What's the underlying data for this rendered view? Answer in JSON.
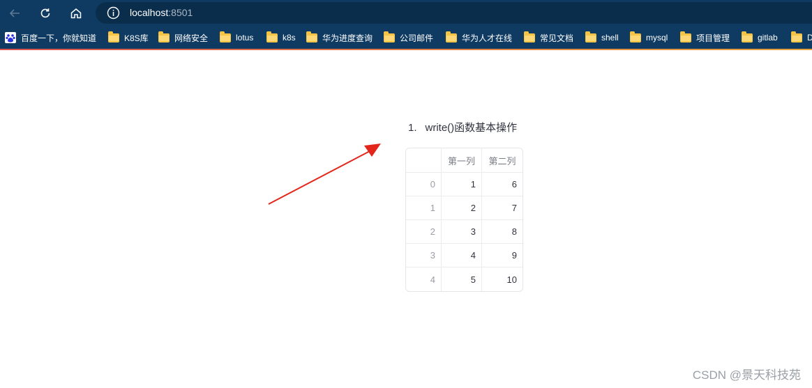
{
  "browser": {
    "url_host": "localhost",
    "url_port": ":8501",
    "bookmarks": [
      {
        "label": "百度一下，你就知道",
        "icon": "baidu-icon"
      },
      {
        "label": "K8S库",
        "icon": "folder-icon"
      },
      {
        "label": "网络安全",
        "icon": "folder-icon"
      },
      {
        "label": "lotus",
        "icon": "folder-icon"
      },
      {
        "label": "k8s",
        "icon": "folder-icon"
      },
      {
        "label": "华为进度查询",
        "icon": "folder-icon"
      },
      {
        "label": "公司邮件",
        "icon": "folder-icon"
      },
      {
        "label": "华为人才在线",
        "icon": "folder-icon"
      },
      {
        "label": "常见文档",
        "icon": "folder-icon"
      },
      {
        "label": "shell",
        "icon": "folder-icon"
      },
      {
        "label": "mysql",
        "icon": "folder-icon"
      },
      {
        "label": "项目管理",
        "icon": "folder-icon"
      },
      {
        "label": "gitlab",
        "icon": "folder-icon"
      },
      {
        "label": "D",
        "icon": "folder-icon"
      }
    ]
  },
  "main": {
    "list_number": "1.",
    "heading": "write()函数基本操作",
    "table": {
      "columns": [
        "",
        "第一列",
        "第二列"
      ],
      "rows": [
        {
          "index": "0",
          "col1": "1",
          "col2": "6"
        },
        {
          "index": "1",
          "col1": "2",
          "col2": "7"
        },
        {
          "index": "2",
          "col1": "3",
          "col2": "8"
        },
        {
          "index": "3",
          "col1": "4",
          "col2": "9"
        },
        {
          "index": "4",
          "col1": "5",
          "col2": "10"
        }
      ]
    }
  },
  "watermark": "CSDN @景天科技苑",
  "colors": {
    "chrome_bg": "#0f3b62",
    "omnibox_bg": "#0b2d4c",
    "annotation_arrow": "#e3261b"
  }
}
